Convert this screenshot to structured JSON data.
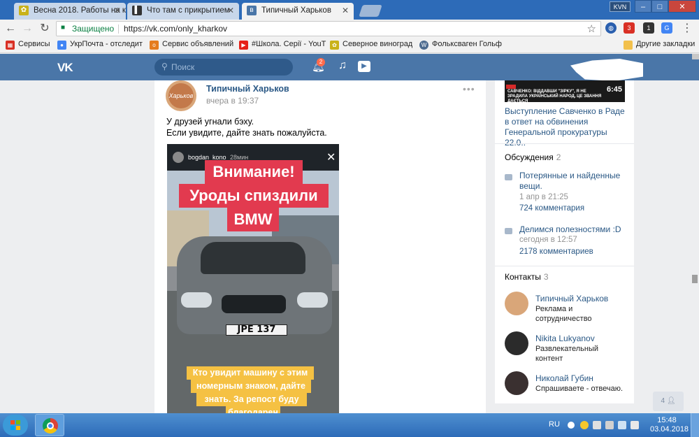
{
  "browser": {
    "tabs": [
      {
        "title": "Весна 2018. Работы на к",
        "active": false
      },
      {
        "title": "Что там с прикрытием",
        "active": false
      },
      {
        "title": "Типичный Харьков",
        "active": true
      }
    ],
    "profile": "KVN",
    "window_buttons": [
      "–",
      "□",
      "✕"
    ],
    "secure_label": "Защищено",
    "url": "https://vk.com/only_kharkov",
    "ext_badges": [
      "3",
      "1"
    ],
    "bookmarks": [
      {
        "label": "Сервисы",
        "icon": "apps-icon",
        "color": "#d93025"
      },
      {
        "label": "УкрПочта - отследит",
        "icon": "search-icon",
        "color": "#4285f4"
      },
      {
        "label": "Сервис объявлений",
        "icon": "olx-icon",
        "color": "#e57c1e"
      },
      {
        "label": "#Школа. Серії - YouT",
        "icon": "youtube-icon",
        "color": "#e62117"
      },
      {
        "label": "Северное виноград",
        "icon": "grape-icon",
        "color": "#c9b21a"
      },
      {
        "label": "Фольксваген Гольф",
        "icon": "vw-icon",
        "color": "#4d6b8f"
      },
      {
        "label": "Другие закладки",
        "icon": "folder-icon",
        "color": "#f2c04c"
      }
    ]
  },
  "vk": {
    "logo": "VK",
    "search_placeholder": "Поиск",
    "notif_count": "2"
  },
  "post": {
    "author": "Типичный Харьков",
    "avatar_text": "Харьков",
    "time": "вчера в 19:37",
    "more": "•••",
    "text_line1": "У друзей угнали бэху.",
    "text_line2": "Если увидите, дайте знать пожалуйста.",
    "story": {
      "user": "bogdan_kono",
      "ago": "28мин",
      "red_lines": [
        "Внимание!",
        "Уроды спиздили",
        "BMW"
      ],
      "plate": "JPE 137",
      "yellow_lines": [
        "Кто увидит машину с этим",
        "номерным знаком, дайте",
        "знать. За репост буду",
        "благодарен"
      ]
    }
  },
  "sidebar": {
    "video": {
      "caption": "САВЧЕНКО: ВІДДАВШИ \"ЗІРКУ\", Я НЕ ЗРАДИЛА УКРАЇНСЬКИЙ НАРОД, ЦЕ ЗВАННЯ ДАЄТЬСЯ",
      "duration": "6:45",
      "title": "Выступление Савченко в Раде в ответ на обвинения Генеральной прокуратуры 22.0.."
    },
    "discussions": {
      "label": "Обсуждения",
      "count": "2",
      "items": [
        {
          "title": "Потерянные и найденные вещи.",
          "date": "1 апр в 21:25",
          "comments": "724 комментария"
        },
        {
          "title": "Делимся полезностями :D",
          "date": "сегодня в 12:57",
          "comments": "2178 комментариев"
        }
      ]
    },
    "contacts": {
      "label": "Контакты",
      "count": "3",
      "items": [
        {
          "name": "Типичный Харьков",
          "desc": "Реклама и сотрудничество",
          "color": "#d9a679"
        },
        {
          "name": "Nikita Lukyanov",
          "desc": "Развлекательный контент",
          "color": "#2b2b2b"
        },
        {
          "name": "Николай Губин",
          "desc": "Спрашиваете - отвечаю.",
          "color": "#3a3030"
        }
      ]
    },
    "pager": "4"
  },
  "taskbar": {
    "lang": "RU",
    "time": "15:48",
    "date": "03.04.2018"
  },
  "colors": {
    "vk_blue": "#4a76a8",
    "link": "#2a5885",
    "story_red": "#e23a4f",
    "story_yellow": "#f5c143"
  }
}
